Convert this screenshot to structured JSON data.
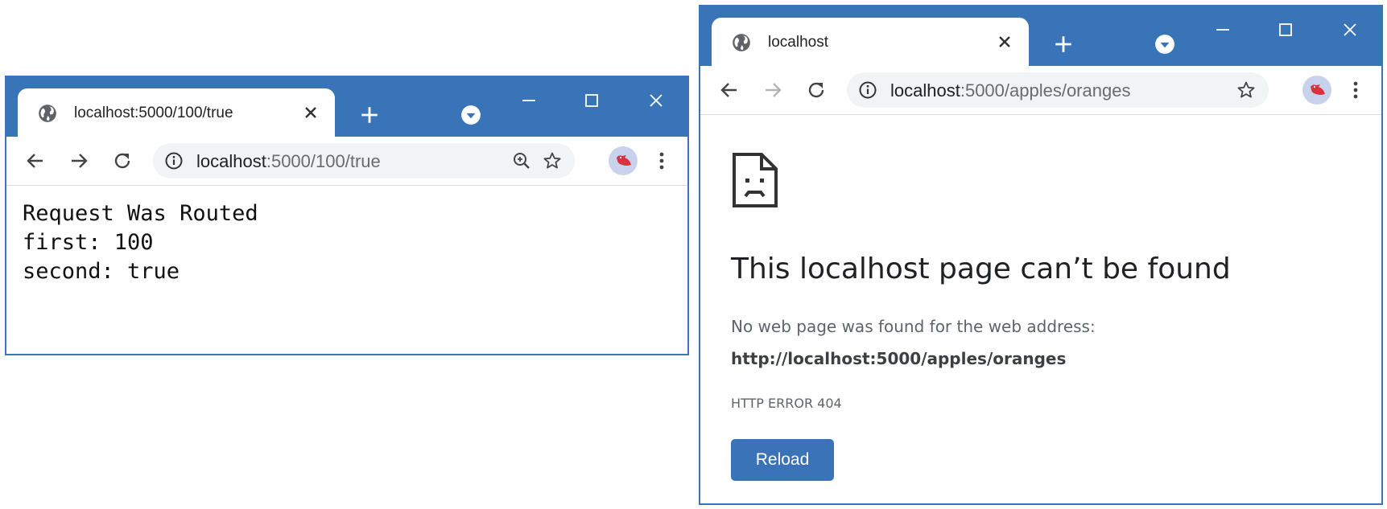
{
  "colors": {
    "frame_blue": "#3a74b8",
    "reload_button": "#3b73b9",
    "omnibox_bg": "#f1f3f4",
    "avatar_bg": "#c9d2ec",
    "avatar_bird": "#d9323e"
  },
  "left_window": {
    "tab": {
      "title": "localhost:5000/100/true",
      "icon": "globe-icon"
    },
    "address_bar": {
      "host": "localhost",
      "path": ":5000/100/true"
    },
    "toolbar_icons": [
      "back-icon",
      "forward-icon",
      "reload-icon",
      "info-icon",
      "zoom-icon",
      "star-icon",
      "avatar",
      "menu-icon"
    ],
    "content": {
      "line1": "Request Was Routed",
      "line2": "first: 100",
      "line3": "second: true"
    }
  },
  "right_window": {
    "tab": {
      "title": "localhost",
      "icon": "globe-icon"
    },
    "address_bar": {
      "host": "localhost",
      "path": ":5000/apples/oranges"
    },
    "toolbar_icons": [
      "back-icon",
      "forward-icon",
      "reload-icon",
      "info-icon",
      "star-icon",
      "avatar",
      "menu-icon"
    ],
    "error": {
      "icon": "sad-page-icon",
      "title": "This localhost page can’t be found",
      "description": "No web page was found for the web address:",
      "url": "http://localhost:5000/apples/oranges",
      "code": "HTTP ERROR 404",
      "reload_label": "Reload"
    }
  }
}
